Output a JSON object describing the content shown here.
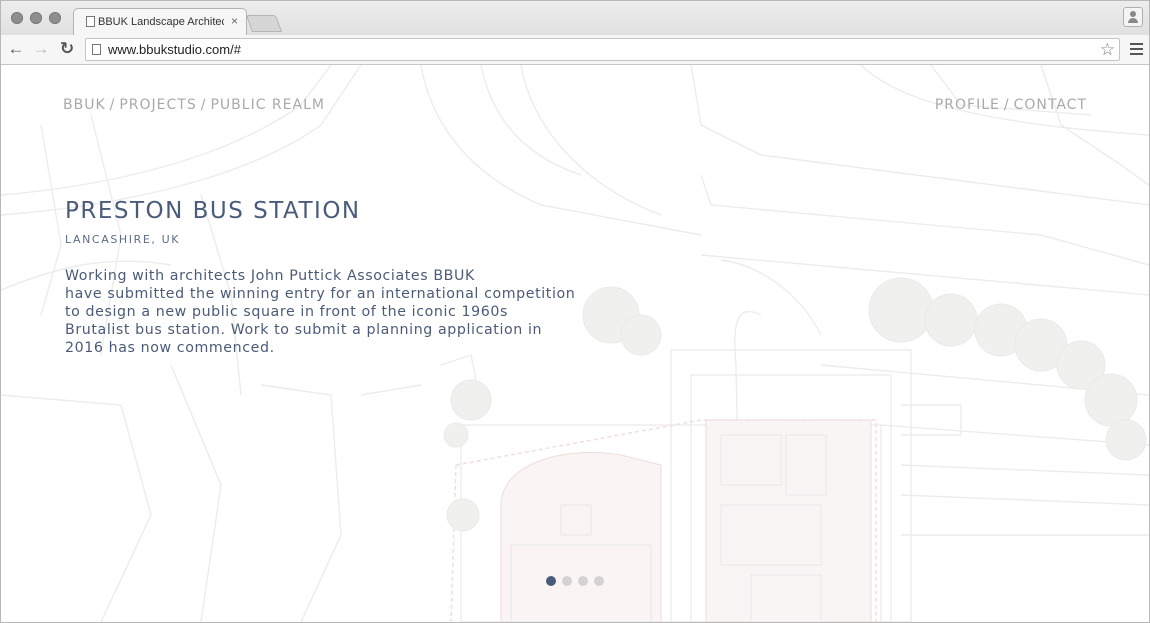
{
  "browser": {
    "tab_title": "BBUK Landscape Architects",
    "tab_close": "×",
    "url": "www.bbukstudio.com/#",
    "back_icon": "←",
    "forward_icon": "→",
    "reload_icon": "↻",
    "star_icon": "☆"
  },
  "site": {
    "breadcrumb": [
      "BBUK",
      "PROJECTS",
      "PUBLIC REALM"
    ],
    "breadcrumb_sep": "/",
    "nav_right": [
      "PROFILE",
      "CONTACT"
    ],
    "project": {
      "title": "PRESTON BUS STATION",
      "location": "LANCASHIRE, UK",
      "description_lines": [
        "Working with architects John Puttick Associates BBUK",
        "have submitted the winning entry for an international competition",
        "to design a new public square in front of the iconic 1960s",
        "Brutalist bus station.   Work to submit a planning application in",
        "2016 has now commenced."
      ]
    },
    "slider": {
      "count": 4,
      "active_index": 0
    }
  },
  "colors": {
    "accent": "#4a5c7a",
    "nav_grey": "#a9a9a9",
    "dot_inactive": "#d3d3d3"
  }
}
